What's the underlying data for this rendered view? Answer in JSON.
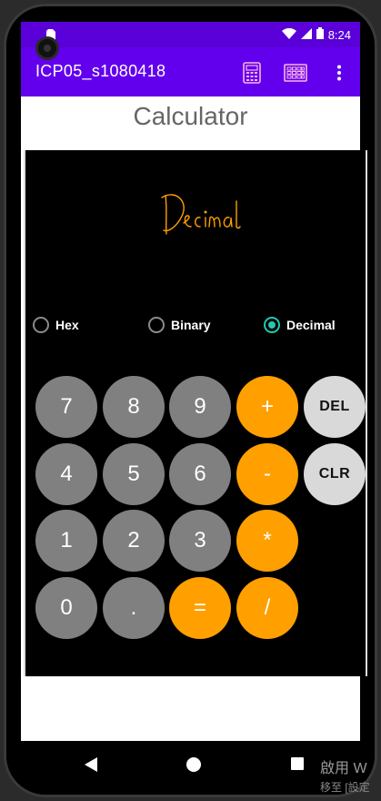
{
  "status": {
    "time": "8:24"
  },
  "appbar": {
    "title": "ICP05_s1080418",
    "icons": [
      "calculator-icon",
      "keyboard-icon",
      "overflow-menu-icon"
    ]
  },
  "page_title": "Calculator",
  "logo_text": "Decimal",
  "mode": {
    "options": [
      {
        "label": "Hex",
        "checked": false
      },
      {
        "label": "Binary",
        "checked": false
      },
      {
        "label": "Decimal",
        "checked": true
      }
    ]
  },
  "keypad": {
    "rows": [
      [
        "7",
        "8",
        "9",
        "+",
        "DEL"
      ],
      [
        "4",
        "5",
        "6",
        "-",
        "CLR"
      ],
      [
        "1",
        "2",
        "3",
        "*"
      ],
      [
        "0",
        ".",
        "=",
        "/"
      ]
    ]
  },
  "colors": {
    "appbar": "#6200ee",
    "statusbar": "#5a00d8",
    "key_gray": "#808080",
    "key_orange": "#ff9f00",
    "key_light": "#d9d9d9",
    "radio_accent": "#26c6b0"
  },
  "watermark": {
    "line1": "啟用 W",
    "line2": "移至 [設定"
  }
}
